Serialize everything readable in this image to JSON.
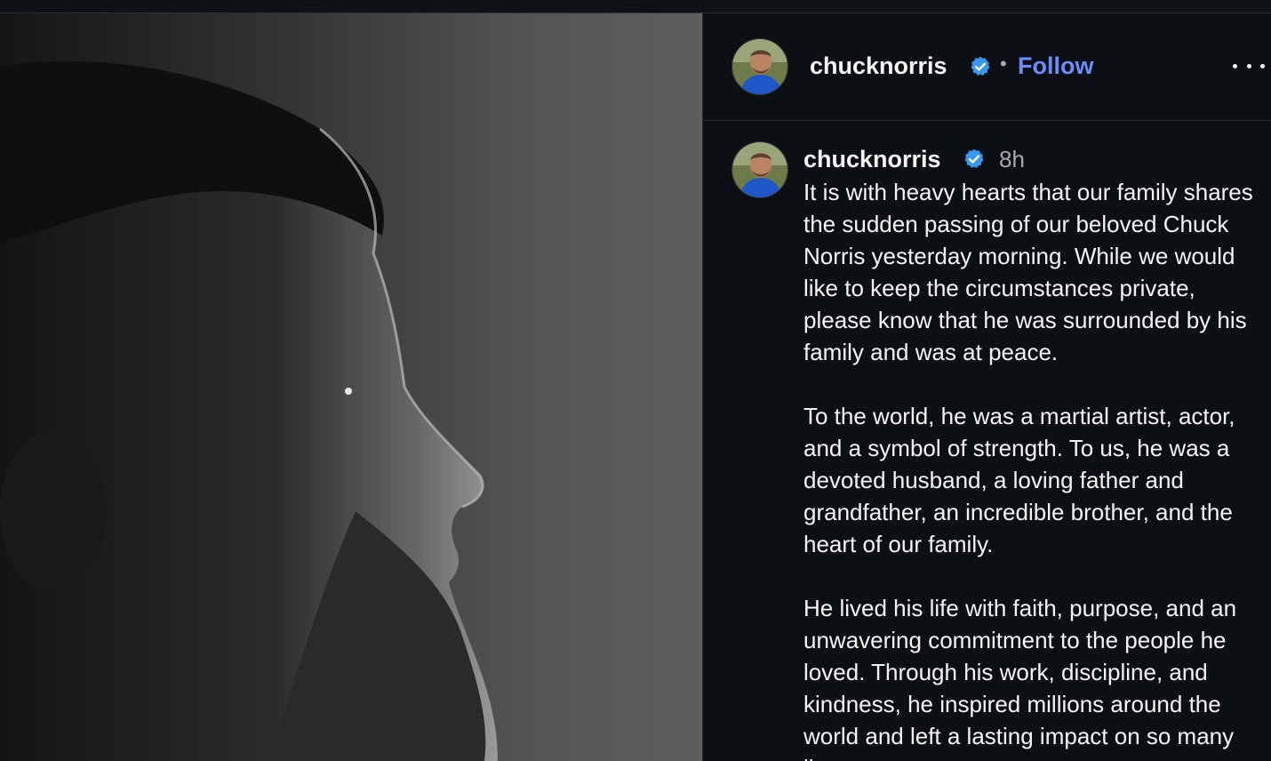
{
  "post": {
    "author": {
      "username": "chucknorris",
      "verified_icon": "verified-badge-icon",
      "follow_label": "Follow",
      "separator": "•"
    },
    "more_icon": "more-options-icon",
    "caption": {
      "username": "chucknorris",
      "time": "8h",
      "text": "It is with heavy hearts that our family shares the sudden passing of our beloved Chuck Norris yesterday morning. While we would like to keep the circumstances private, please know that he was surrounded by his family and was at peace.\n\nTo the world, he was a martial artist, actor, and a symbol of strength. To us, he was a devoted husband, a loving father and grandfather, an incredible brother, and the heart of our family.\n\nHe lived his life with faith, purpose, and an unwavering commitment to the people he loved. Through his work, discipline, and kindness, he inspired millions around the world and left a lasting impact on so many lives."
    }
  },
  "colors": {
    "background": "#0c1014",
    "link": "#6b8cff",
    "verified": "#3897f0",
    "muted": "#a8a8a8"
  }
}
